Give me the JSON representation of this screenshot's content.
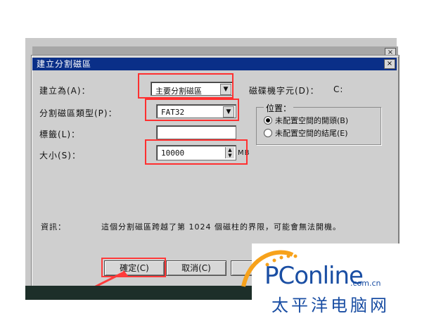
{
  "dialog": {
    "title": "建立分割磁區",
    "close_glyph": "×"
  },
  "form": {
    "build_as_label": "建立為(A)：",
    "build_as_value": "主要分割磁區",
    "drive_letter_label": "磁碟機字元(D)：",
    "drive_letter_value": "C:",
    "type_label": "分割磁區類型(P)：",
    "type_value": "FAT32",
    "label_label": "標籤(L)：",
    "label_value": "",
    "size_label": "大小(S)：",
    "size_value": "10000",
    "size_unit": "MB"
  },
  "position_group": {
    "title": "位置：",
    "options": [
      {
        "label": "未配置空間的開頭(B)",
        "selected": true
      },
      {
        "label": "未配置空間的結尾(E)",
        "selected": false
      }
    ]
  },
  "info": {
    "label": "資訊：",
    "message": "這個分割磁區跨越了第 1024 個磁柱的界限，可能會無法開機。"
  },
  "buttons": {
    "ok": "確定(C)",
    "cancel": "取消(C)"
  },
  "watermark": {
    "brand": "PConline",
    "domain": ".com.cn",
    "chinese": "太平洋电脑网"
  },
  "colors": {
    "highlight_box": "#ff3030",
    "titlebar": "#0a2f88"
  }
}
